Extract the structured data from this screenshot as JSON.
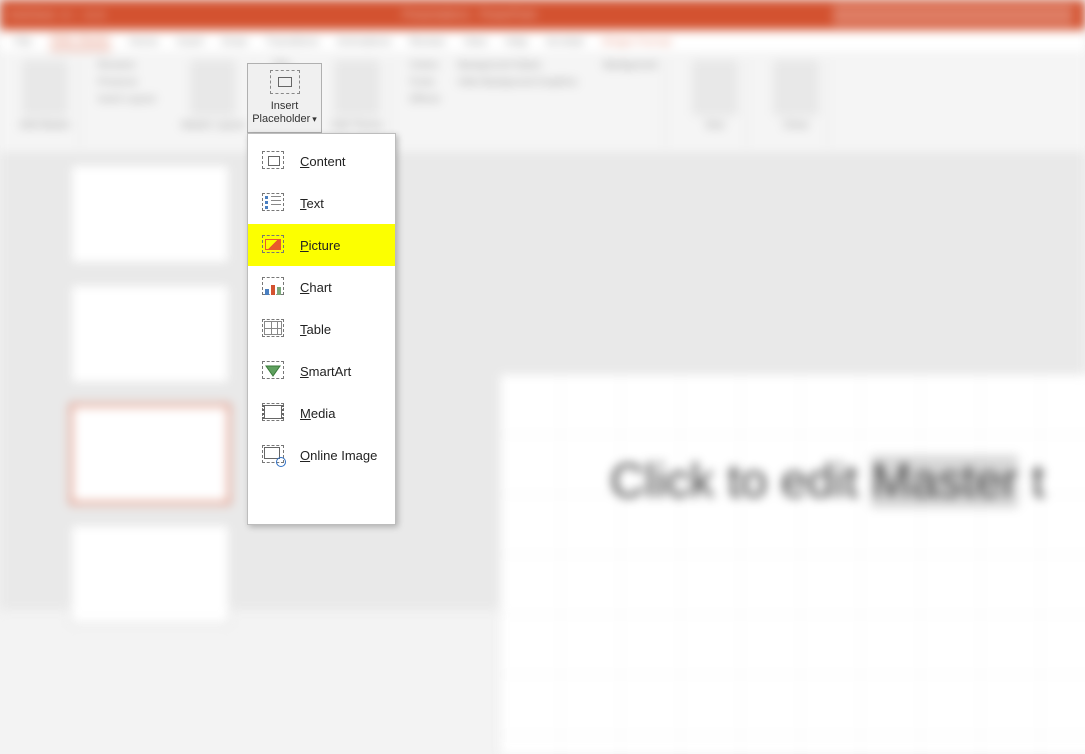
{
  "title_bar": {
    "autosave_label": "AutoSave",
    "doc_title": "Presentation1 - PowerPoint",
    "search_placeholder": "Search"
  },
  "tabs": {
    "file": "File",
    "slide_master": "Slide Master",
    "home": "Home",
    "insert": "Insert",
    "draw": "Draw",
    "transitions": "Transitions",
    "animations": "Animations",
    "review": "Review",
    "view": "View",
    "help": "Help",
    "acrobat": "Acrobat",
    "shape_format": "Shape Format"
  },
  "ribbon": {
    "insert_placeholder": {
      "line1": "Insert",
      "line2": "Placeholder"
    },
    "group_edit_master": "Edit Master",
    "group_master_layout": "Master Layout",
    "group_edit_theme": "Edit Theme",
    "group_background": "Background",
    "group_size": "Size",
    "group_close": "Close",
    "colors": "Colors",
    "fonts": "Fonts",
    "effects": "Effects",
    "bg_styles": "Background Styles",
    "hide_bg": "Hide Background Graphics",
    "title_chk": "Title",
    "footers_chk": "Footers",
    "rename": "Rename",
    "preserve": "Preserve",
    "insert_layout": "Insert Layout",
    "slide_size": "Slide Size",
    "close_master": "Close Master View"
  },
  "dropdown": {
    "items": [
      {
        "label": "Content",
        "accel": "C",
        "icon": "content-icon"
      },
      {
        "label": "Text",
        "accel": "T",
        "icon": "text-icon"
      },
      {
        "label": "Picture",
        "accel": "P",
        "icon": "picture-icon",
        "highlighted": true
      },
      {
        "label": "Chart",
        "accel": "C",
        "icon": "chart-icon"
      },
      {
        "label": "Table",
        "accel": "T",
        "icon": "table-icon"
      },
      {
        "label": "SmartArt",
        "accel": "S",
        "icon": "smartart-icon"
      },
      {
        "label": "Media",
        "accel": "M",
        "icon": "media-icon"
      },
      {
        "label": "Online Image",
        "accel": "O",
        "icon": "online-image-icon"
      }
    ]
  },
  "canvas": {
    "placeholder_text_prefix": "Click to edit ",
    "placeholder_text_selword": "Master",
    "placeholder_text_suffix": " t"
  }
}
